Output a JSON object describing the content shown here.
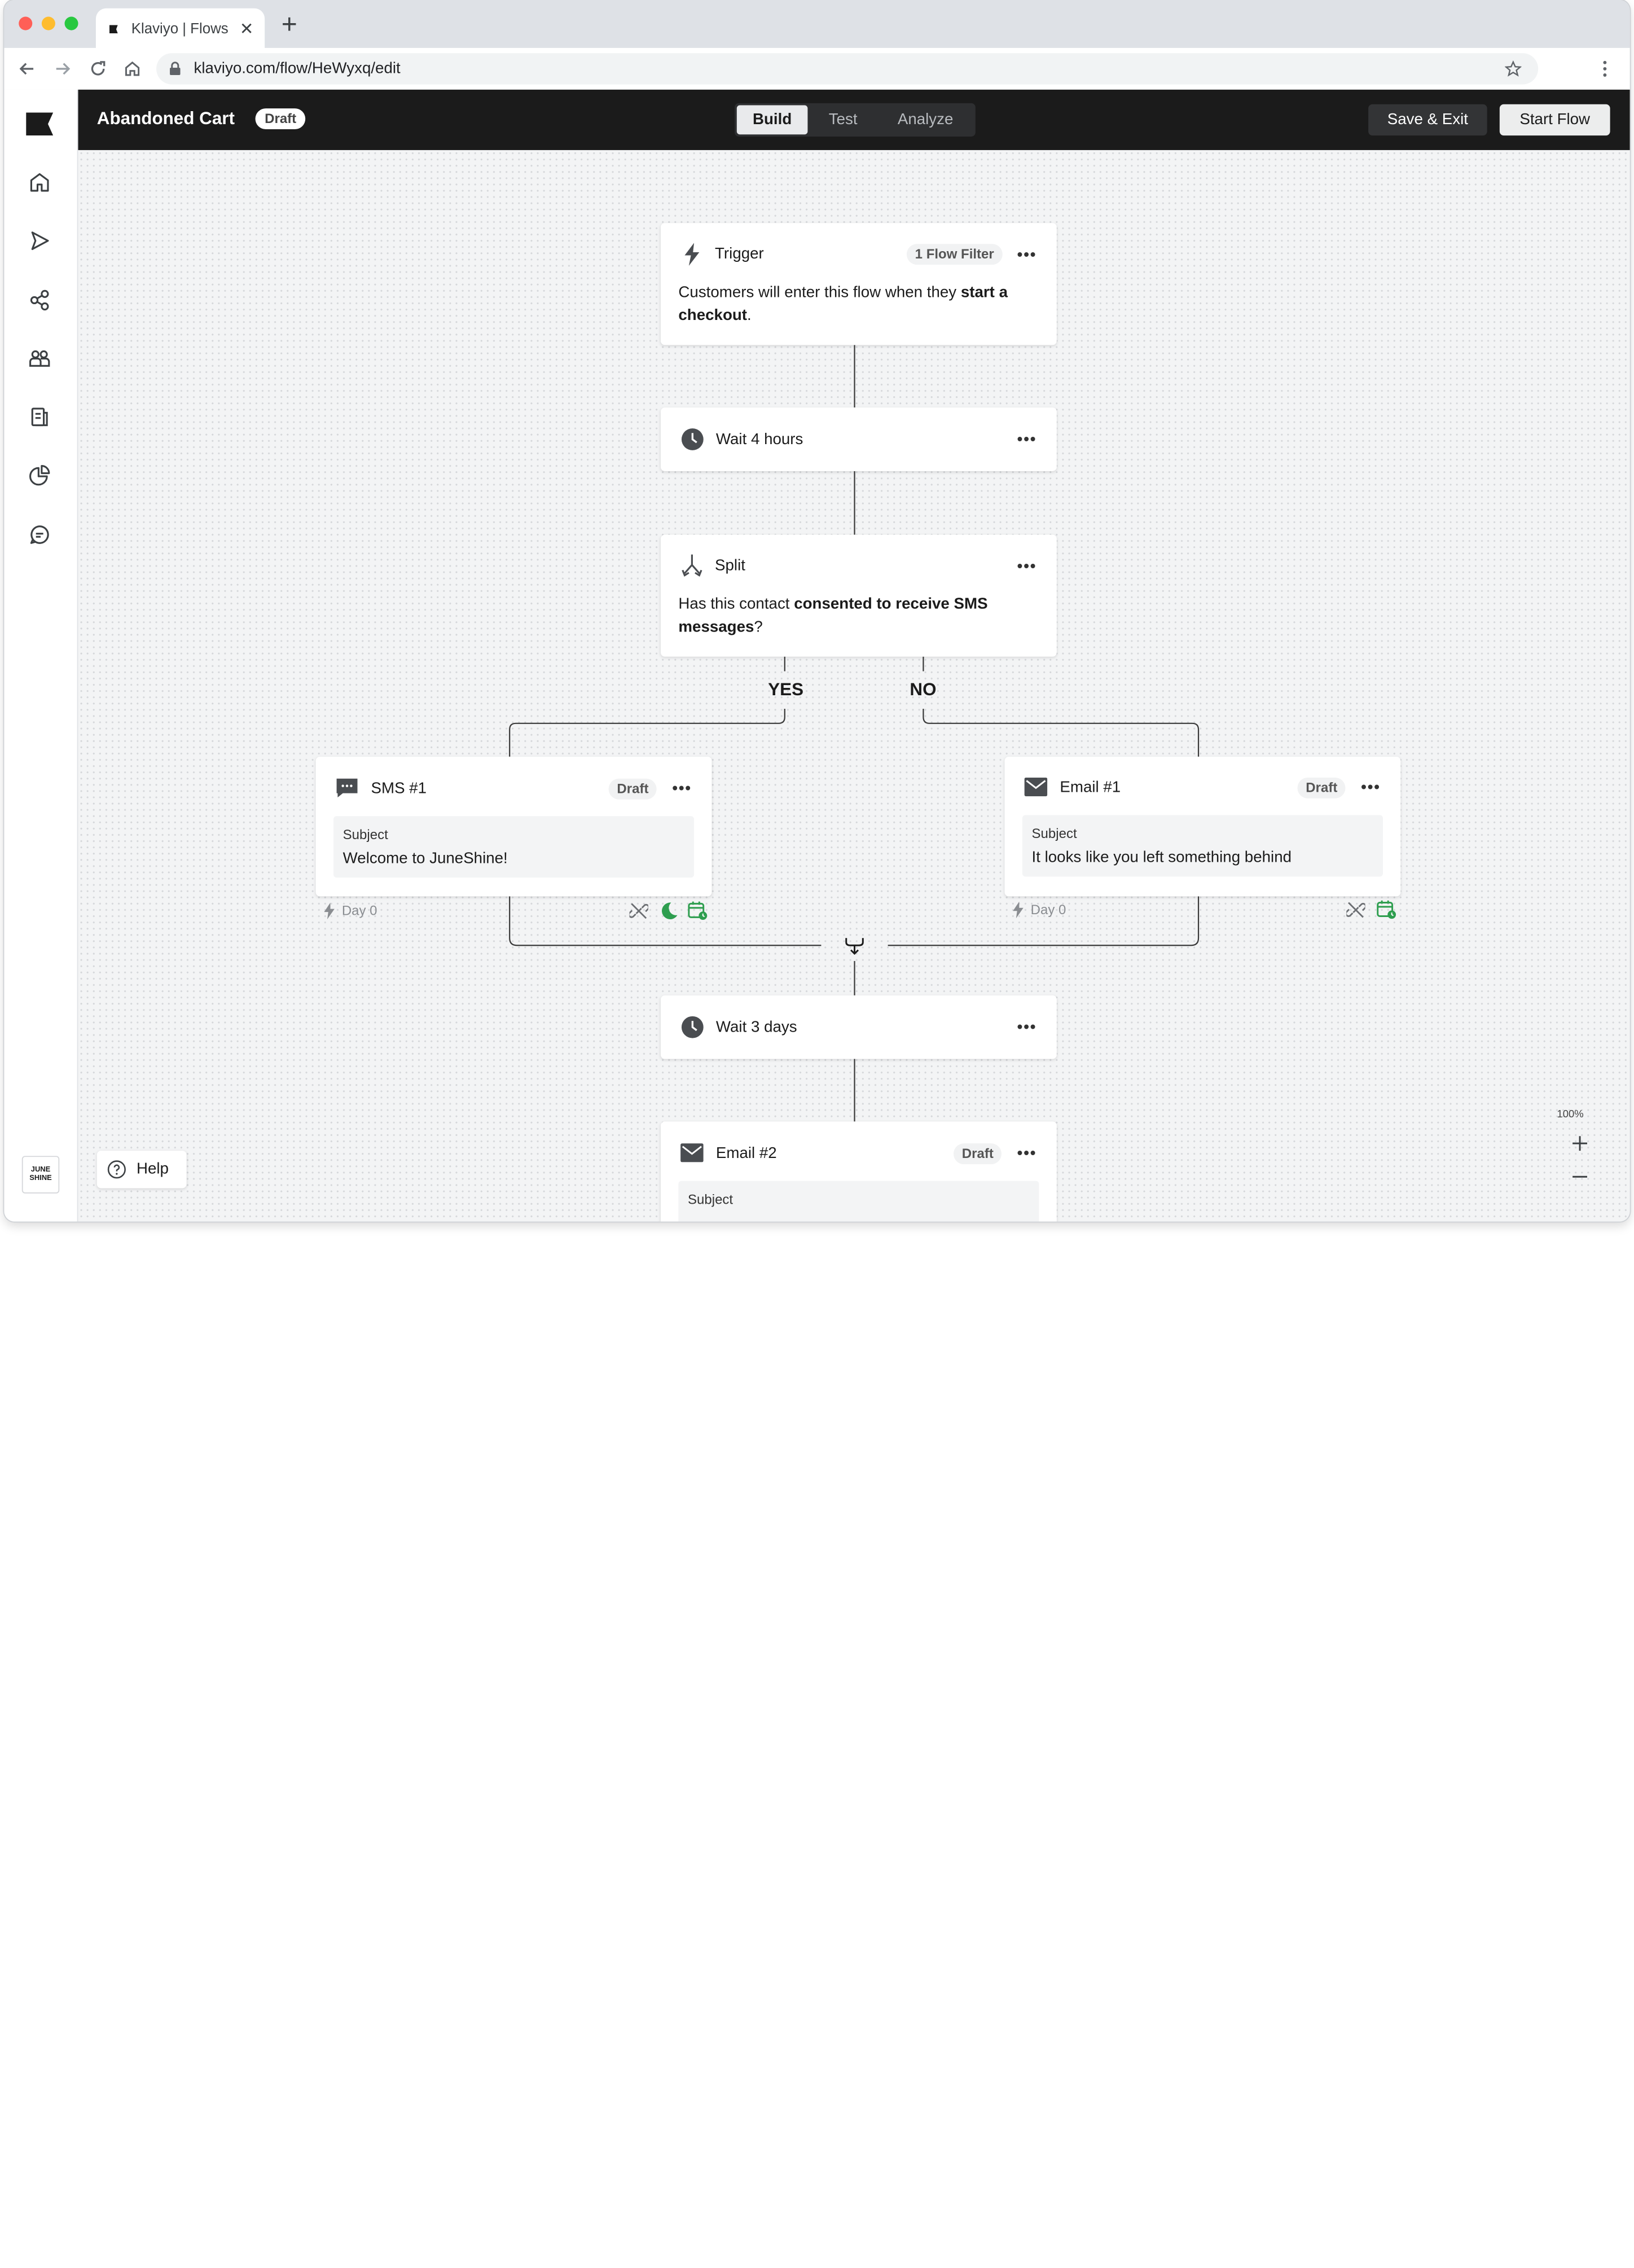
{
  "browser": {
    "tab_title": "Klaviyo | Flows",
    "url": "klaviyo.com/flow/HeWyxq/edit"
  },
  "header": {
    "flow_name": "Abandoned Cart",
    "status_badge": "Draft",
    "tabs": [
      {
        "label": "Build",
        "active": true
      },
      {
        "label": "Test",
        "active": false
      },
      {
        "label": "Analyze",
        "active": false
      }
    ],
    "save_exit_label": "Save & Exit",
    "start_flow_label": "Start Flow"
  },
  "sidebar": {
    "items": [
      {
        "icon": "home-icon"
      },
      {
        "icon": "campaigns-send-icon"
      },
      {
        "icon": "flows-icon"
      },
      {
        "icon": "audience-icon"
      },
      {
        "icon": "content-icon"
      },
      {
        "icon": "analytics-icon"
      },
      {
        "icon": "conversations-icon"
      }
    ],
    "account_logo_line1": "JUNE",
    "account_logo_line2": "SHINE"
  },
  "flow": {
    "trigger": {
      "title": "Trigger",
      "filter_badge": "1 Flow Filter",
      "body_prefix": "Customers will enter this flow when they ",
      "body_bold": "start a checkout",
      "body_suffix": "."
    },
    "wait1": {
      "title": "Wait 4 hours"
    },
    "split": {
      "title": "Split",
      "body_prefix": "Has this contact ",
      "body_bold": "consented to receive SMS messages",
      "body_suffix": "?",
      "yes_label": "YES",
      "no_label": "NO"
    },
    "sms1": {
      "title": "SMS #1",
      "badge": "Draft",
      "subject_label": "Subject",
      "subject_value": "Welcome to JuneShine!",
      "day_label": "Day 0"
    },
    "email1": {
      "title": "Email #1",
      "badge": "Draft",
      "subject_label": "Subject",
      "subject_value": "It looks like you left something behind",
      "day_label": "Day 0"
    },
    "wait2": {
      "title": "Wait 3 days"
    },
    "email2": {
      "title": "Email #2",
      "badge": "Draft",
      "subject_label": "Subject"
    }
  },
  "canvas": {
    "zoom_label": "100%",
    "help_label": "Help"
  },
  "colors": {
    "header_bg": "#1b1b1b",
    "accent_green": "#2e9e4f",
    "canvas_bg": "#f3f4f5"
  }
}
